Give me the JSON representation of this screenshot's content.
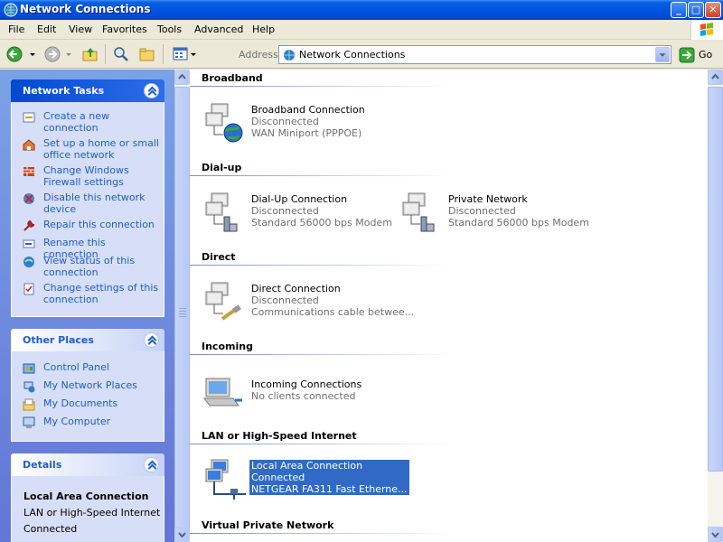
{
  "window": {
    "title": "Network Connections"
  },
  "menu": [
    "File",
    "Edit",
    "View",
    "Favorites",
    "Tools",
    "Advanced",
    "Help"
  ],
  "toolbar": {
    "address_label": "Address",
    "address_value": "Network Connections",
    "go_label": "Go"
  },
  "network_tasks": {
    "title": "Network Tasks",
    "items": [
      {
        "label": "Create a new connection",
        "icon": "new-connection-icon"
      },
      {
        "label": "Set up a home or small office network",
        "icon": "home-network-icon"
      },
      {
        "label": "Change Windows Firewall settings",
        "icon": "firewall-icon"
      },
      {
        "label": "Disable this network device",
        "icon": "disable-icon"
      },
      {
        "label": "Repair this connection",
        "icon": "repair-icon"
      },
      {
        "label": "Rename this connection",
        "icon": "rename-icon"
      },
      {
        "label": "View status of this connection",
        "icon": "status-icon"
      },
      {
        "label": "Change settings of this connection",
        "icon": "settings-icon"
      }
    ]
  },
  "other_places": {
    "title": "Other Places",
    "items": [
      {
        "label": "Control Panel",
        "icon": "control-panel-icon"
      },
      {
        "label": "My Network Places",
        "icon": "network-places-icon"
      },
      {
        "label": "My Documents",
        "icon": "documents-icon"
      },
      {
        "label": "My Computer",
        "icon": "computer-icon"
      }
    ]
  },
  "details": {
    "title": "Details",
    "name": "Local Area Connection",
    "type": "LAN or High-Speed Internet",
    "status": "Connected"
  },
  "groups": [
    {
      "title": "Broadband",
      "items": [
        {
          "name": "Broadband Connection",
          "status": "Disconnected",
          "device": "WAN Miniport (PPPOE)"
        }
      ]
    },
    {
      "title": "Dial-up",
      "items": [
        {
          "name": "Dial-Up Connection",
          "status": "Disconnected",
          "device": "Standard 56000 bps Modem"
        },
        {
          "name": "Private Network",
          "status": "Disconnected",
          "device": "Standard 56000 bps Modem"
        }
      ]
    },
    {
      "title": "Direct",
      "items": [
        {
          "name": "Direct Connection",
          "status": "Disconnected",
          "device": "Communications cable betwee..."
        }
      ]
    },
    {
      "title": "Incoming",
      "items": [
        {
          "name": "Incoming Connections",
          "status": "No clients connected",
          "device": ""
        }
      ]
    },
    {
      "title": "LAN or High-Speed Internet",
      "items": [
        {
          "name": "Local Area Connection",
          "status": "Connected",
          "device": "NETGEAR FA311 Fast Etherne..."
        }
      ]
    },
    {
      "title": "Virtual Private Network",
      "items": []
    }
  ],
  "colors": {
    "title_bar": "#0054e3",
    "link": "#215dc6",
    "selection": "#316ac5"
  }
}
